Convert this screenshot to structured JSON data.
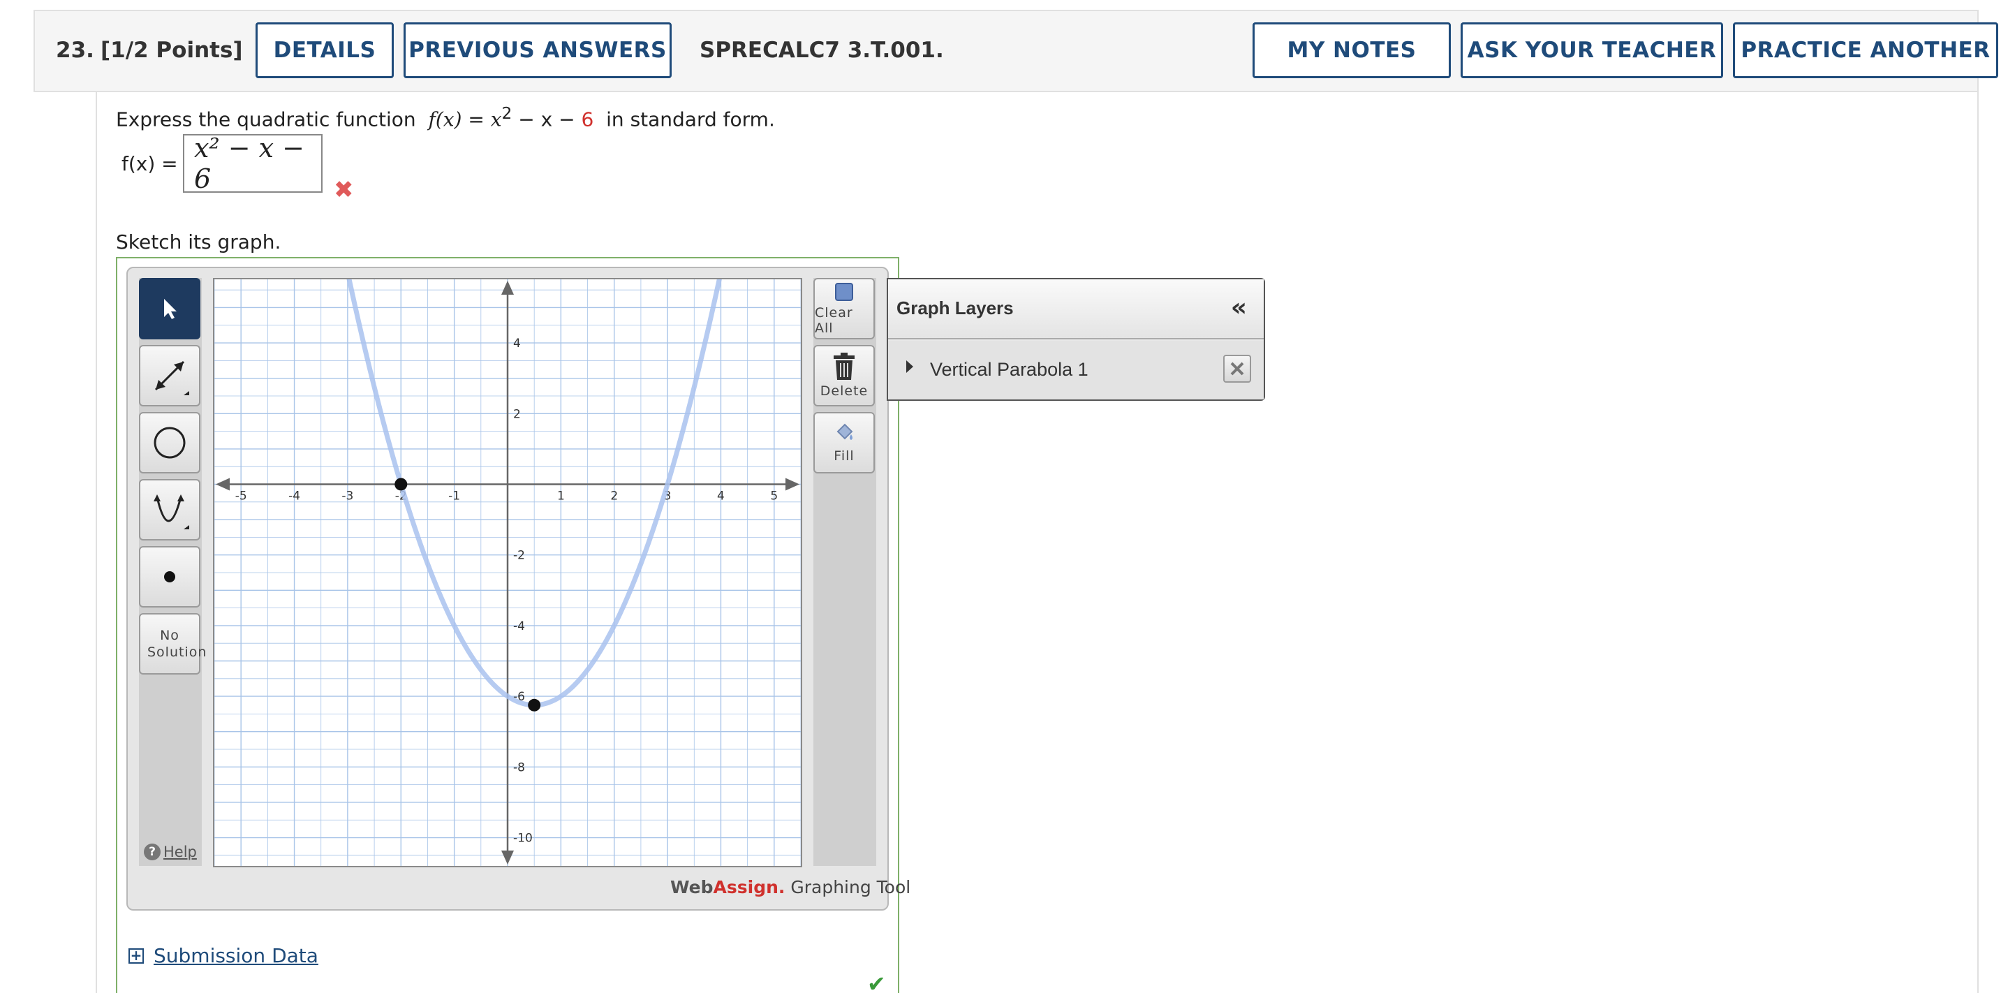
{
  "header": {
    "number": "23.",
    "points": "[1/2 Points]",
    "details_label": "DETAILS",
    "previous_answers_label": "PREVIOUS ANSWERS",
    "problem_id": "SPRECALC7 3.T.001.",
    "my_notes_label": "MY NOTES",
    "ask_teacher_label": "ASK YOUR TEACHER",
    "practice_label": "PRACTICE ANOTHER"
  },
  "question": {
    "prompt_before": "Express the quadratic function",
    "fx": "f(x)",
    "equals": "=",
    "expr_x2": "x",
    "expr_exp": "2",
    "expr_rest": "− x −",
    "expr_const": "6",
    "prompt_after": "in standard form.",
    "answer_label": "f(x) =",
    "answer_value": "x² − x − 6",
    "answer_status": "✖",
    "sketch_prompt": "Sketch its graph."
  },
  "graph_tool": {
    "tools": {
      "pointer": "pointer-tool",
      "line": "line-tool",
      "circle": "circle-tool",
      "parabola": "parabola-tool",
      "point": "point-tool",
      "no_solution": "No Solution"
    },
    "clear_all_label": "Clear All",
    "delete_label": "Delete",
    "fill_label": "Fill",
    "help_label": "Help",
    "brand_web": "Web",
    "brand_assign": "Assign.",
    "brand_suffix": " Graphing Tool",
    "layers_title": "Graph Layers",
    "collapse_symbol": "«",
    "layers": [
      {
        "name": "Vertical Parabola 1"
      }
    ]
  },
  "chart_data": {
    "type": "line",
    "xlim": [
      -5.5,
      5.5
    ],
    "ylim": [
      -10.8,
      5.8
    ],
    "x_ticks": [
      -5,
      -4,
      -3,
      -2,
      -1,
      1,
      2,
      3,
      4,
      5
    ],
    "y_ticks": [
      4,
      2,
      -2,
      -4,
      -6,
      -8,
      -10
    ],
    "grid": true,
    "curve": {
      "a": 1,
      "h": 0.5,
      "k": -6.25
    },
    "points": [
      {
        "x": -2,
        "y": 0
      },
      {
        "x": 0.5,
        "y": -6.25
      }
    ],
    "colors": {
      "curve": "#a9c2ee",
      "grid": "#a8c4e8",
      "axis": "#666666",
      "point": "#111111"
    }
  },
  "submission_label": "Submission Data",
  "submission_status": "✔"
}
